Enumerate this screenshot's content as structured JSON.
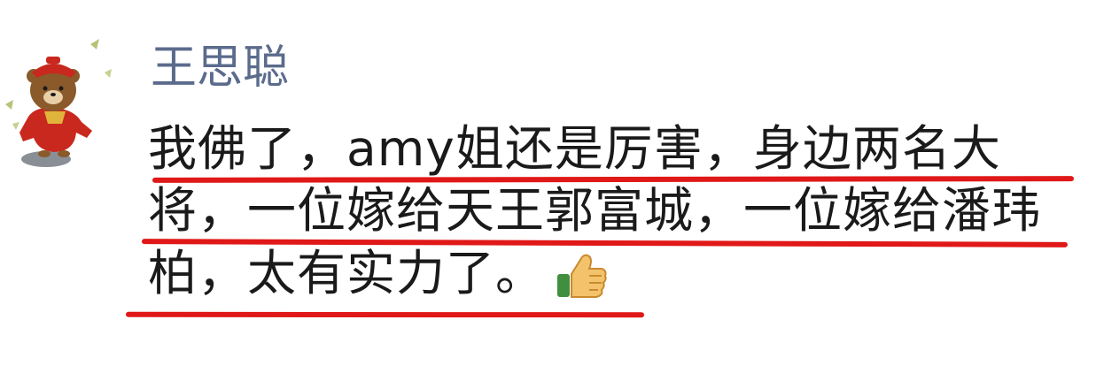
{
  "comment": {
    "username": "王思聪",
    "lines": [
      "我佛了，amy姐还是厉害，身边两名大",
      "将，一位嫁给天王郭富城，一位嫁给潘玮",
      "柏，太有实力了。"
    ],
    "avatar_icon": "brown-bear-sticker-icon",
    "emoji_icon": "thumbs-up-icon",
    "colors": {
      "username": "#5b6b8c",
      "text": "#1a1a1a",
      "underline": "#e01818"
    }
  }
}
